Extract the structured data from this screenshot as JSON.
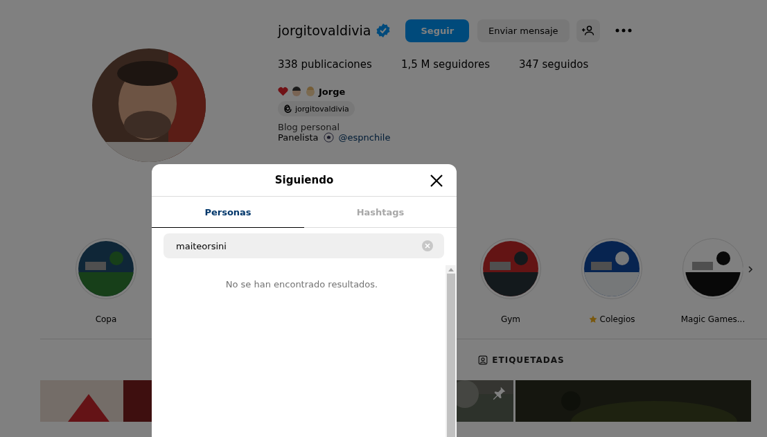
{
  "profile": {
    "username": "jorgitovaldivia",
    "verified": true,
    "follow_button": "Seguir",
    "message_button": "Enviar mensaje",
    "stats": [
      {
        "value": "338",
        "label": "publicaciones"
      },
      {
        "value": "1,5 M",
        "label": "seguidores"
      },
      {
        "value": "347",
        "label": "seguidos"
      }
    ],
    "name": "Jorge",
    "threads_handle": "jorgitovaldivia",
    "category": "Blog personal",
    "bio": "Panelista",
    "mention": "@espnchile"
  },
  "highlights": [
    {
      "label": "Copa",
      "star": false
    },
    {
      "label": "Gym",
      "star": false
    },
    {
      "label": "Colegios",
      "star": true
    },
    {
      "label": "Magic Games...",
      "star": false
    }
  ],
  "profile_tabs": [
    {
      "label": "ETIQUETADAS",
      "selected": false
    }
  ],
  "modal": {
    "title": "Siguiendo",
    "tabs": [
      {
        "label": "Personas",
        "selected": true
      },
      {
        "label": "Hashtags",
        "selected": false
      }
    ],
    "search": {
      "value": "maiteorsini"
    },
    "empty_message": "No se han encontrado resultados."
  }
}
